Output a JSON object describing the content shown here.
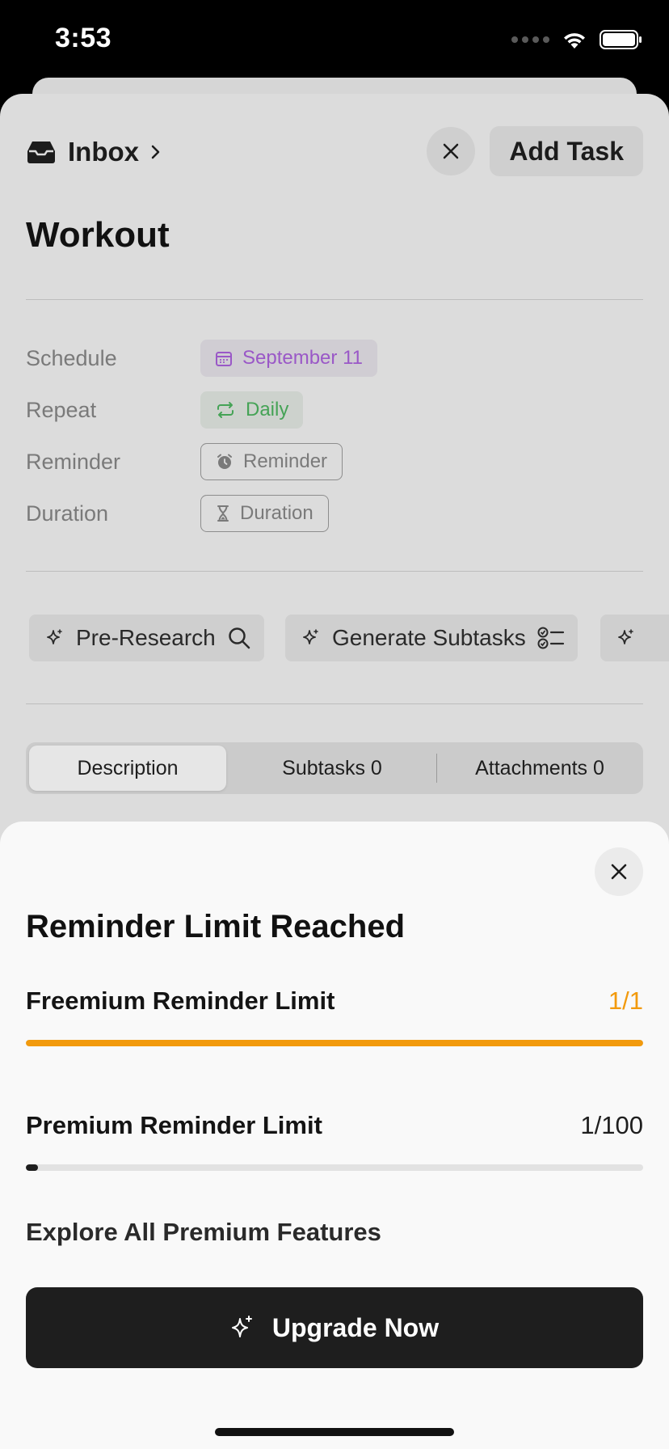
{
  "status_bar": {
    "time": "3:53"
  },
  "header": {
    "breadcrumb_label": "Inbox",
    "add_task_label": "Add Task"
  },
  "task": {
    "title": "Workout"
  },
  "properties": [
    {
      "label": "Schedule",
      "value": "September 11",
      "icon": "calendar-icon",
      "color": "#9a58c7"
    },
    {
      "label": "Repeat",
      "value": "Daily",
      "icon": "repeat-icon",
      "color": "#45a356"
    },
    {
      "label": "Reminder",
      "value": "Reminder",
      "icon": "alarm-icon",
      "color": "#7a7a7a"
    },
    {
      "label": "Duration",
      "value": "Duration",
      "icon": "hourglass-icon",
      "color": "#7a7a7a"
    }
  ],
  "ai_actions": [
    {
      "label": "Pre-Research",
      "icon": "search-icon"
    },
    {
      "label": "Generate Subtasks",
      "icon": "checklist-icon"
    }
  ],
  "tabs": [
    {
      "label": "Description",
      "active": true
    },
    {
      "label": "Subtasks 0",
      "active": false
    },
    {
      "label": "Attachments 0",
      "active": false
    }
  ],
  "modal": {
    "title": "Reminder Limit Reached",
    "freemium": {
      "label": "Freemium Reminder Limit",
      "value": "1/1",
      "fraction": 1.0,
      "color": "#f29a0d"
    },
    "premium": {
      "label": "Premium Reminder Limit",
      "value": "1/100",
      "fraction": 0.01,
      "color": "#1e1e1e"
    },
    "explore_label": "Explore All Premium Features",
    "upgrade_label": "Upgrade Now"
  }
}
